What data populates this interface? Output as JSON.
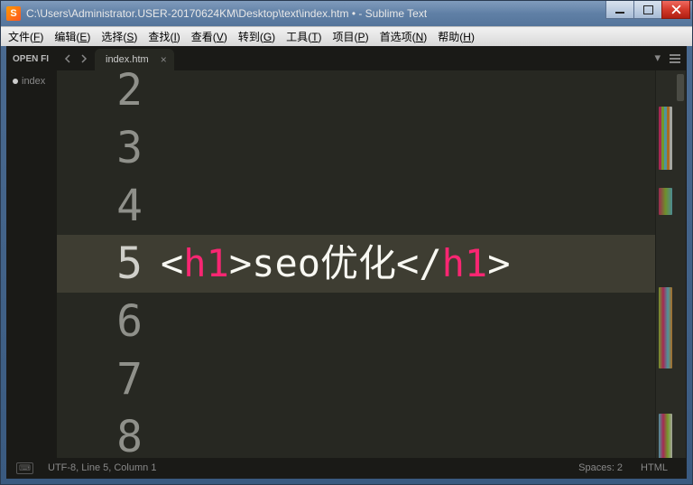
{
  "window": {
    "title": "C:\\Users\\Administrator.USER-20170624KM\\Desktop\\text\\index.htm • - Sublime Text",
    "app_icon_char": "S"
  },
  "menubar": {
    "items": [
      {
        "label": "文件",
        "accel": "F"
      },
      {
        "label": "编辑",
        "accel": "E"
      },
      {
        "label": "选择",
        "accel": "S"
      },
      {
        "label": "查找",
        "accel": "I"
      },
      {
        "label": "查看",
        "accel": "V"
      },
      {
        "label": "转到",
        "accel": "G"
      },
      {
        "label": "工具",
        "accel": "T"
      },
      {
        "label": "项目",
        "accel": "P"
      },
      {
        "label": "首选项",
        "accel": "N"
      },
      {
        "label": "帮助",
        "accel": "H"
      }
    ]
  },
  "tabs": {
    "open_files_label": "OPEN FI",
    "active_tab": "index.htm"
  },
  "sidebar": {
    "open_file_label": "index"
  },
  "editor": {
    "visible_lines": [
      2,
      3,
      4,
      5,
      6,
      7,
      8
    ],
    "current_line": 5,
    "line5": {
      "open_angle": "<",
      "tag_open": "h1",
      "close_angle1": ">",
      "text": "seo优化",
      "open_angle2": "</",
      "tag_close": "h1",
      "close_angle2": ">"
    }
  },
  "statusbar": {
    "encoding_position": "UTF-8, Line 5, Column 1",
    "spaces": "Spaces: 2",
    "syntax": "HTML"
  }
}
